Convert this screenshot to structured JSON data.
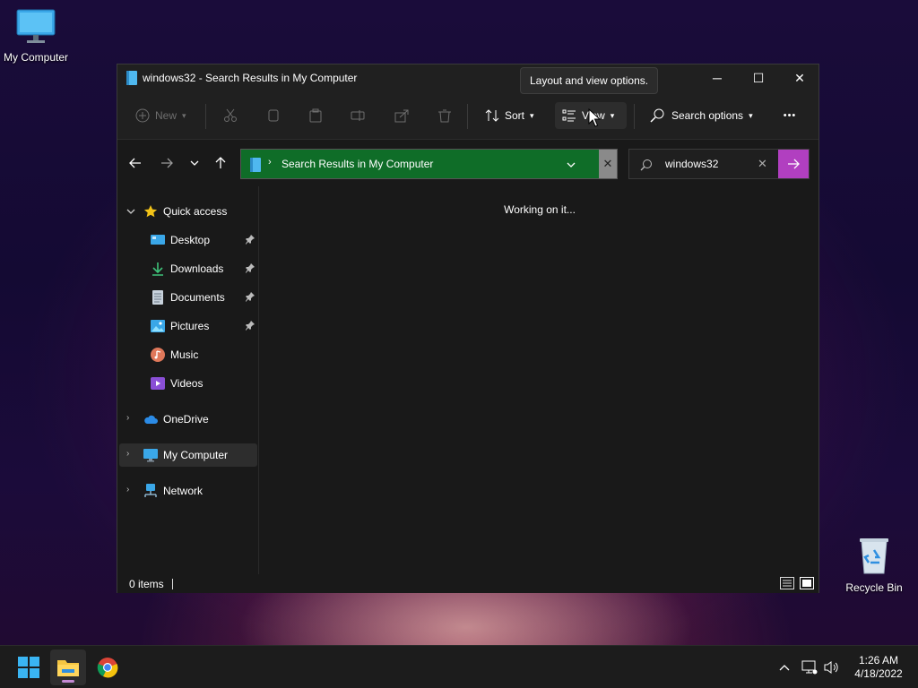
{
  "desktop": {
    "icons": [
      {
        "label": "My Computer",
        "icon": "monitor-icon"
      },
      {
        "label": "Recycle Bin",
        "icon": "recycle-bin-icon"
      }
    ]
  },
  "window": {
    "title": "windows32 - Search Results in My Computer",
    "tooltip": "Layout and view options.",
    "controls": {
      "minimize": "─",
      "maximize": "☐",
      "close": "✕"
    }
  },
  "commandbar": {
    "new_label": "New",
    "sort_label": "Sort",
    "view_label": "View",
    "search_options_label": "Search options",
    "more_label": "•••"
  },
  "nav": {
    "address_text": "Search Results in My Computer",
    "search_value": "windows32"
  },
  "sidebar": {
    "quick_access": "Quick access",
    "items": [
      {
        "label": "Desktop",
        "pinned": true
      },
      {
        "label": "Downloads",
        "pinned": true
      },
      {
        "label": "Documents",
        "pinned": true
      },
      {
        "label": "Pictures",
        "pinned": true
      },
      {
        "label": "Music",
        "pinned": false
      },
      {
        "label": "Videos",
        "pinned": false
      }
    ],
    "onedrive": "OneDrive",
    "my_computer": "My Computer",
    "network": "Network"
  },
  "content": {
    "status_message": "Working on it..."
  },
  "statusbar": {
    "item_count": "0 items"
  },
  "taskbar": {
    "time": "1:26 AM",
    "date": "4/18/2022"
  },
  "colors": {
    "address_bg": "#0f6d28",
    "search_go": "#b13fc0",
    "window_bg": "#191919"
  }
}
